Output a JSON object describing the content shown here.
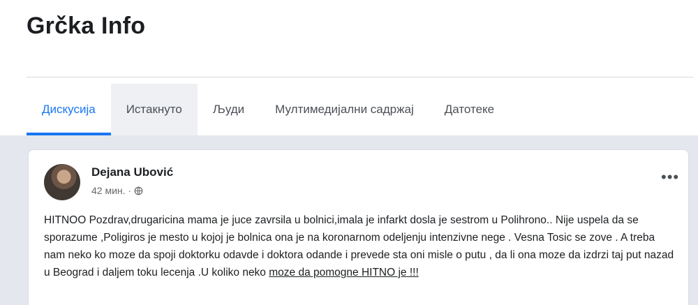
{
  "group": {
    "title": "Grčka Info"
  },
  "tabs": [
    {
      "label": "Дискусија",
      "active": true
    },
    {
      "label": "Истакнуто",
      "active": false
    },
    {
      "label": "Људи",
      "active": false
    },
    {
      "label": "Мултимедијални садржај",
      "active": false
    },
    {
      "label": "Датотеке",
      "active": false
    }
  ],
  "post": {
    "author": "Dejana Ubović",
    "time": "42 мин. ·",
    "privacy_icon": "globe-icon",
    "more_label": "•••",
    "text_main": "HITNOO Pozdrav,drugaricina mama je juce zavrsila u bolnici,imala je infarkt dosla je sestrom u Polihrono.. Nije uspela da se sporazume ,Poligiros je mesto u kojoj je bolnica ona je na koronarnom odeljenju intenzivne nege . Vesna Tosic se zove . A treba nam neko ko moze da spoji doktorku odavde i doktora odande i prevede sta oni misle o putu , da li ona moze da izdrzi taj put nazad u Beograd i daljem toku lecenja .U koliko neko ",
    "text_underlined": "moze da pomogne HITNO je !!!"
  },
  "colors": {
    "accent": "#1877f2",
    "feed_background": "#e4e8ee",
    "text": "#1c1e21",
    "secondary_text": "#65676b"
  }
}
